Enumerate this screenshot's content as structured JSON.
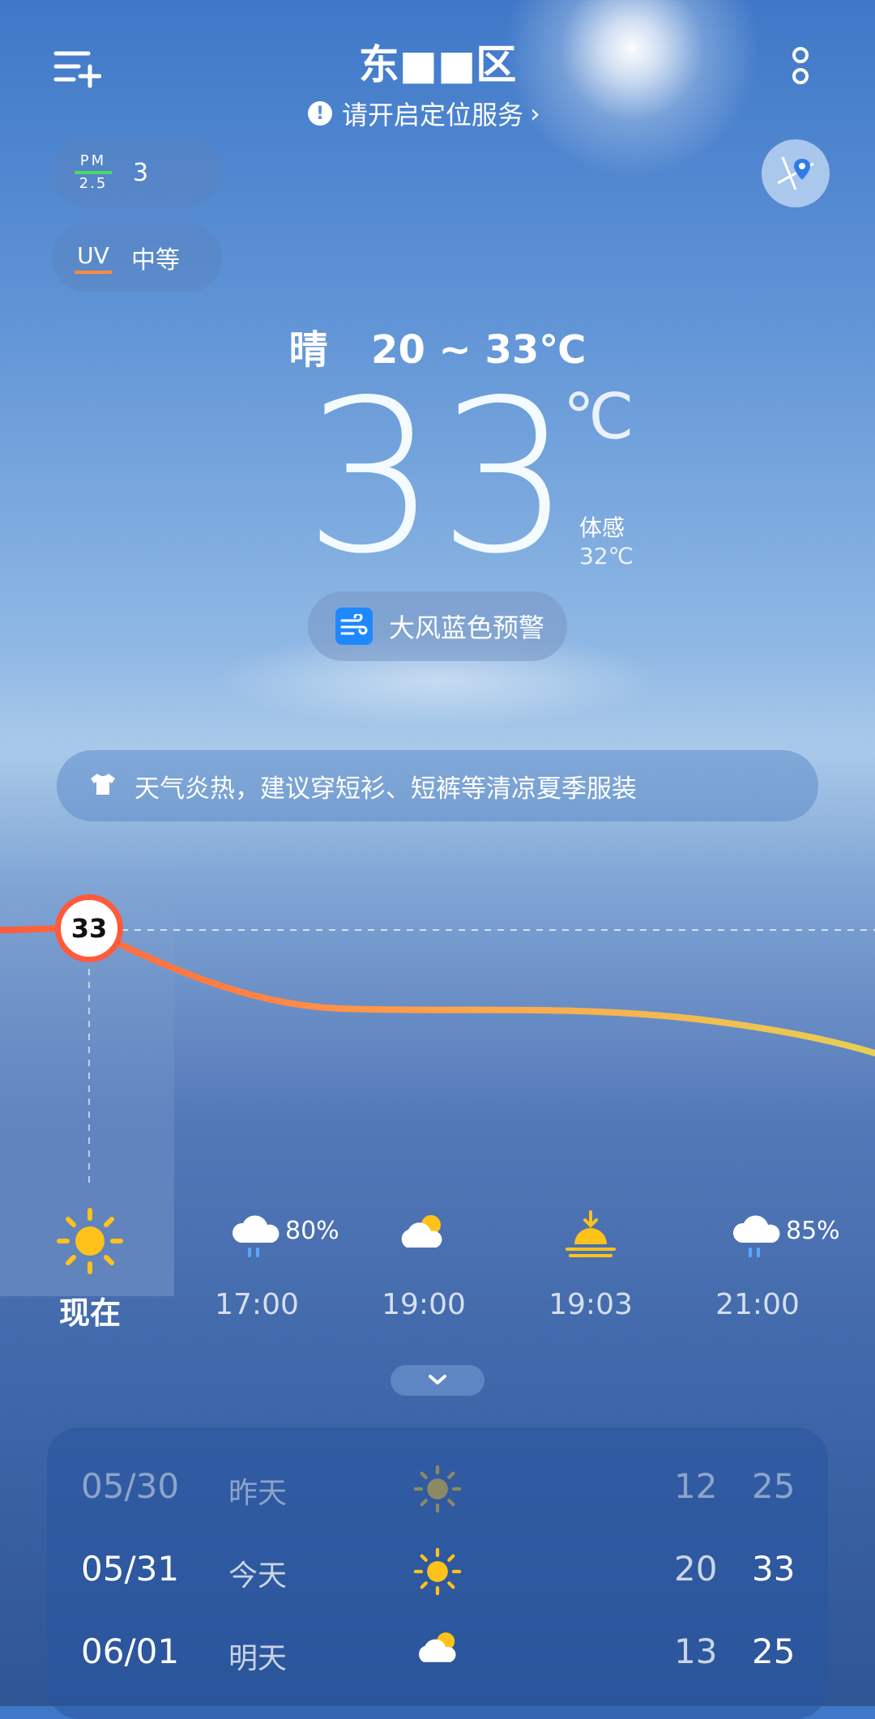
{
  "header": {
    "location_name": "东■■区",
    "location_notice": "请开启定位服务",
    "menu_icon": "add-city-list-icon",
    "more_icon": "vertical-dots-icon",
    "map_icon": "map-pin-icon"
  },
  "badges": {
    "pm25_label_top": "PM",
    "pm25_label_bottom": "2.5",
    "pm25_value": "3",
    "uv_label": "UV",
    "uv_value": "中等"
  },
  "current": {
    "condition": "晴",
    "range": "20 ~ 33℃",
    "temperature": "33",
    "unit": "℃",
    "feels_label": "体感",
    "feels_value": "32℃",
    "alert": "大风蓝色预警",
    "alert_color": "#1e88ff"
  },
  "advice": "天气炎热，建议穿短衫、短裤等清凉夏季服装",
  "hourly": {
    "current_temp_label": "33",
    "items": [
      {
        "time": "现在",
        "icon": "sun-icon",
        "precip": ""
      },
      {
        "time": "17:00",
        "icon": "cloud-rain-icon",
        "precip": "80%"
      },
      {
        "time": "19:00",
        "icon": "partly-cloudy-icon",
        "precip": ""
      },
      {
        "time": "19:03",
        "icon": "sunset-icon",
        "precip": ""
      },
      {
        "time": "21:00",
        "icon": "cloud-rain-icon",
        "precip": "85%"
      }
    ]
  },
  "daily": [
    {
      "date": "05/30",
      "label": "昨天",
      "icon": "sun-icon",
      "low": "12",
      "high": "25"
    },
    {
      "date": "05/31",
      "label": "今天",
      "icon": "sun-icon",
      "low": "20",
      "high": "33"
    },
    {
      "date": "06/01",
      "label": "明天",
      "icon": "partly-cloudy-icon",
      "low": "13",
      "high": "25"
    }
  ]
}
